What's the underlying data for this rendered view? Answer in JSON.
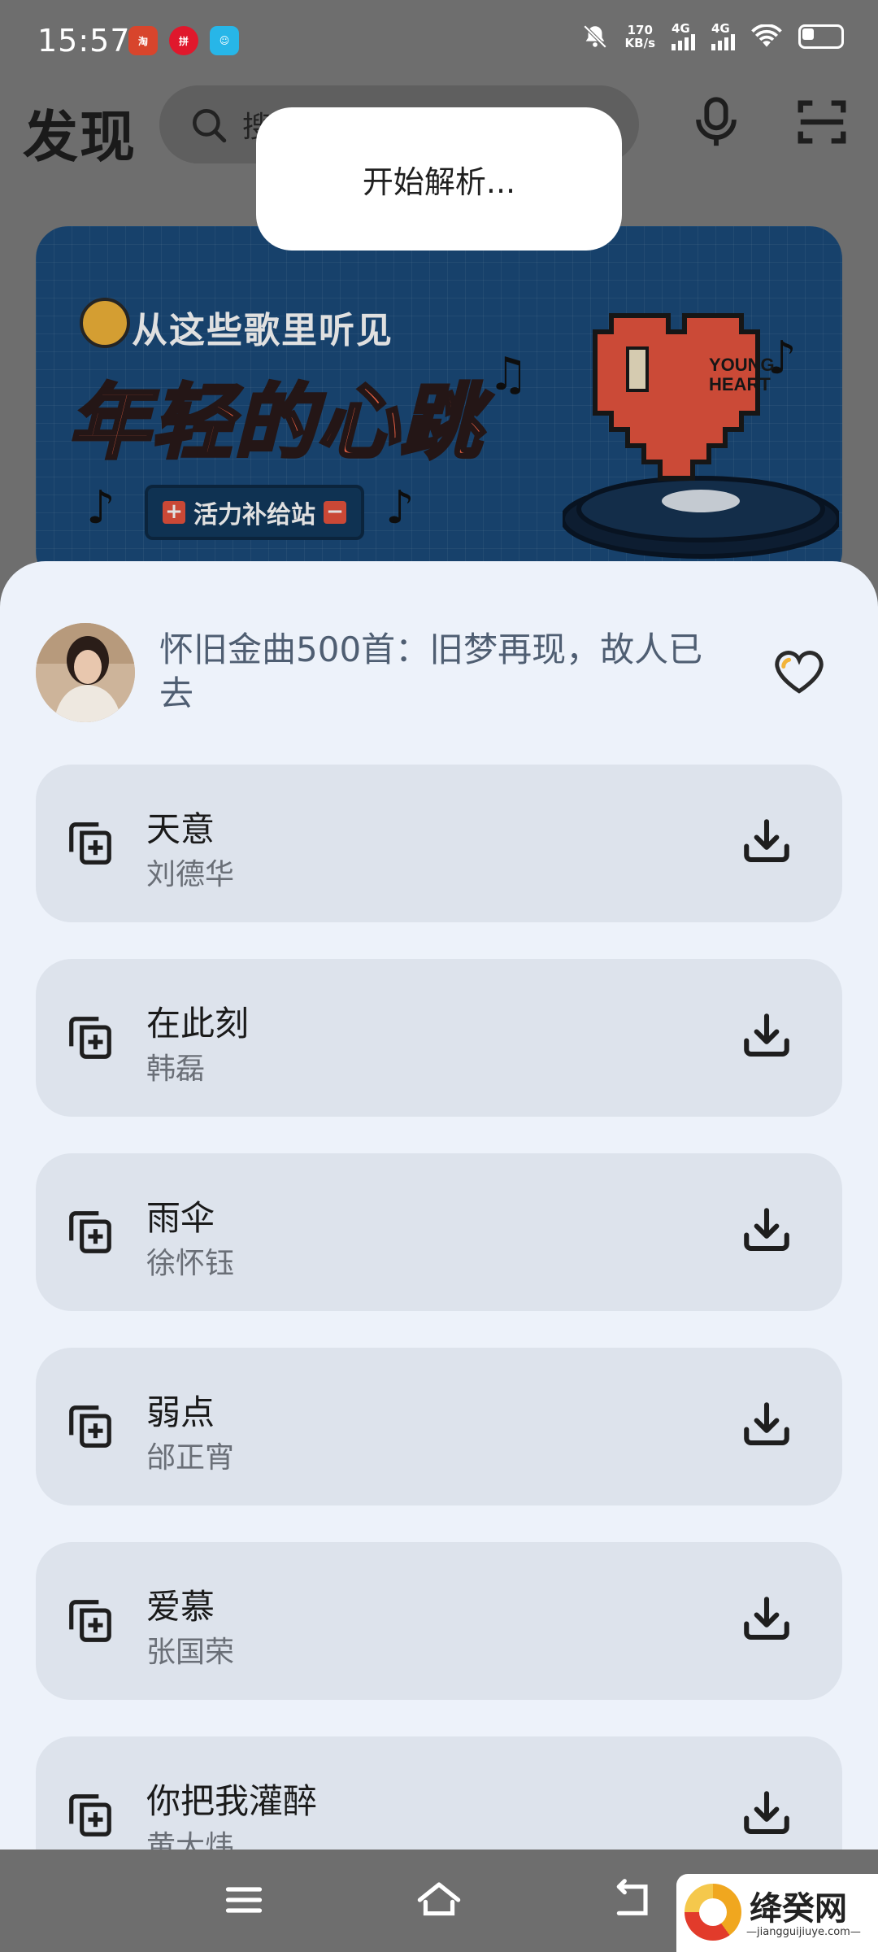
{
  "status_bar": {
    "time": "15:57",
    "apps": [
      "taobao-app",
      "pinduoduo-app",
      "chat-app"
    ],
    "net_speed_value": "170",
    "net_speed_unit": "KB/s",
    "sim1": "4G",
    "sim2": "4G",
    "icons": [
      "mute-bell-icon",
      "signal-icon",
      "wifi-icon",
      "battery-icon"
    ]
  },
  "header": {
    "title": "发现",
    "search_placeholder": "搜",
    "icons": [
      "search-icon",
      "microphone-icon",
      "scan-icon"
    ]
  },
  "banner": {
    "subtitle": "从这些歌里听见",
    "headline": "年轻的心跳",
    "pill_label": "活力补给站",
    "heart_text_1": "YOUNG",
    "heart_text_2": "HEART"
  },
  "toast": {
    "message": "开始解析..."
  },
  "playlist": {
    "title": "怀旧金曲500首：旧梦再现，故人已去",
    "favorite_icon": "heart-icon",
    "songs": [
      {
        "name": "天意",
        "artist": "刘德华"
      },
      {
        "name": "在此刻",
        "artist": "韩磊"
      },
      {
        "name": "雨伞",
        "artist": "徐怀钰"
      },
      {
        "name": "弱点",
        "artist": "邰正宵"
      },
      {
        "name": "爱慕",
        "artist": "张国荣"
      },
      {
        "name": "你把我灌醉",
        "artist": "黄大炜"
      }
    ]
  },
  "nav_bar": {
    "icons": [
      "menu-icon",
      "home-icon",
      "back-icon"
    ]
  },
  "watermark": {
    "text": "绛癸网",
    "url": "—jiangguijiuye.com—"
  },
  "colors": {
    "overlay": "#6e6e6e",
    "sheet": "#edf2fa",
    "card": "#dde3ec",
    "title_text": "#4f5e72",
    "artist_text": "#6a6f77"
  }
}
